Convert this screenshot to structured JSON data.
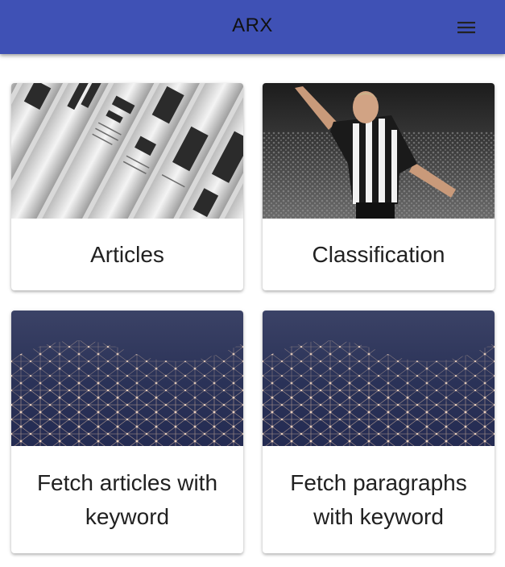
{
  "app": {
    "title": "ARX",
    "brand_color": "#3f51b5",
    "menu_icon": "hamburger-menu-icon"
  },
  "cards": [
    {
      "title": "Articles",
      "image": "newspapers-stack"
    },
    {
      "title": "Classification",
      "image": "soccer-player-celebrating"
    },
    {
      "title": "Fetch articles with keyword",
      "image": "network-mesh"
    },
    {
      "title": "Fetch paragraphs with keyword",
      "image": "network-mesh"
    }
  ]
}
